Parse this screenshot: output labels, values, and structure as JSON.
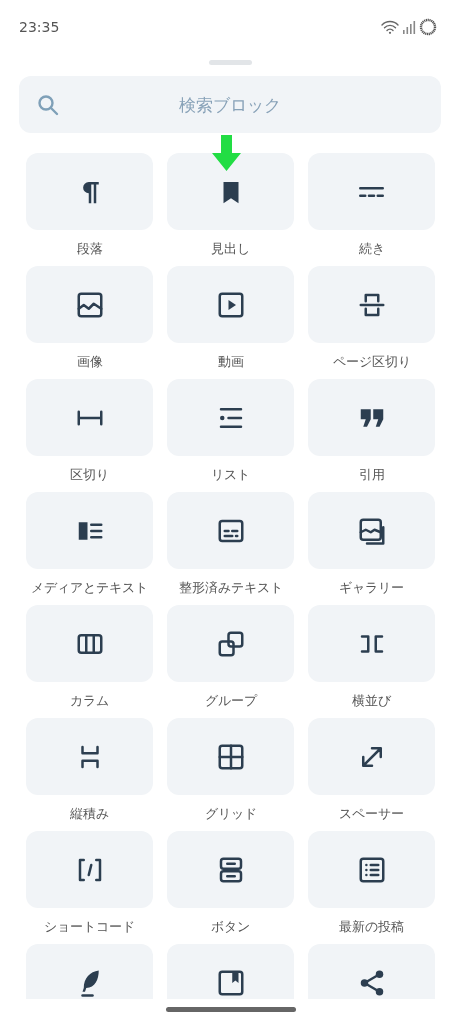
{
  "status_bar": {
    "time": "23:35"
  },
  "search": {
    "placeholder": "検索ブロック"
  },
  "blocks": [
    {
      "label": "段落"
    },
    {
      "label": "見出し"
    },
    {
      "label": "続き"
    },
    {
      "label": "画像"
    },
    {
      "label": "動画"
    },
    {
      "label": "ページ区切り"
    },
    {
      "label": "区切り"
    },
    {
      "label": "リスト"
    },
    {
      "label": "引用"
    },
    {
      "label": "メディアとテキスト"
    },
    {
      "label": "整形済みテキスト"
    },
    {
      "label": "ギャラリー"
    },
    {
      "label": "カラム"
    },
    {
      "label": "グループ"
    },
    {
      "label": "横並び"
    },
    {
      "label": "縦積み"
    },
    {
      "label": "グリッド"
    },
    {
      "label": "スペーサー"
    },
    {
      "label": "ショートコード"
    },
    {
      "label": "ボタン"
    },
    {
      "label": "最新の投稿"
    },
    {
      "kind": "block"
    },
    {
      "kind": "block"
    },
    {
      "kind": "block"
    }
  ]
}
